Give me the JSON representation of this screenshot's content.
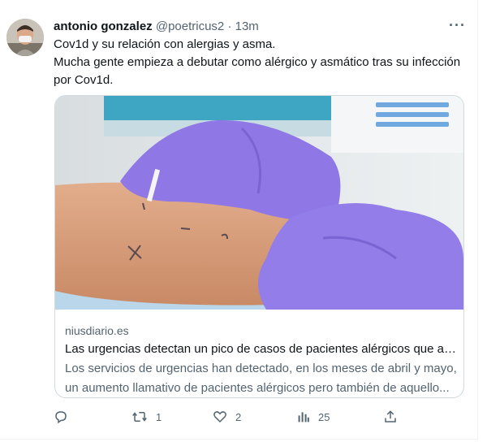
{
  "tweet": {
    "author_name": "antonio gonzalez",
    "handle": "@poetricus2",
    "separator": "·",
    "time": "13m",
    "more_label": "···",
    "text_line1": "Cov1d y su relación con alergias y asma.",
    "text_line2": "Mucha gente empieza a debutar como alérgico y asmático tras su infección por Cov1d."
  },
  "card": {
    "domain": "niusdiario.es",
    "title": "Las urgencias detectan un pico de casos de pacientes alérgicos que ac...",
    "desc_line1": "Los servicios de urgencias han detectado, en los meses de abril y mayo,",
    "desc_line2": "un aumento llamativo de pacientes alérgicos pero también de aquello..."
  },
  "actions": {
    "reply_count": "",
    "retweet_count": "1",
    "like_count": "2",
    "views_count": "25"
  },
  "icons": [
    "reply-icon",
    "retweet-icon",
    "like-icon",
    "views-icon",
    "share-icon",
    "more-icon"
  ],
  "colors": {
    "primary_text": "#0f1419",
    "secondary_text": "#536471",
    "glove": "#8f78e6",
    "border": "#cfd9de"
  }
}
